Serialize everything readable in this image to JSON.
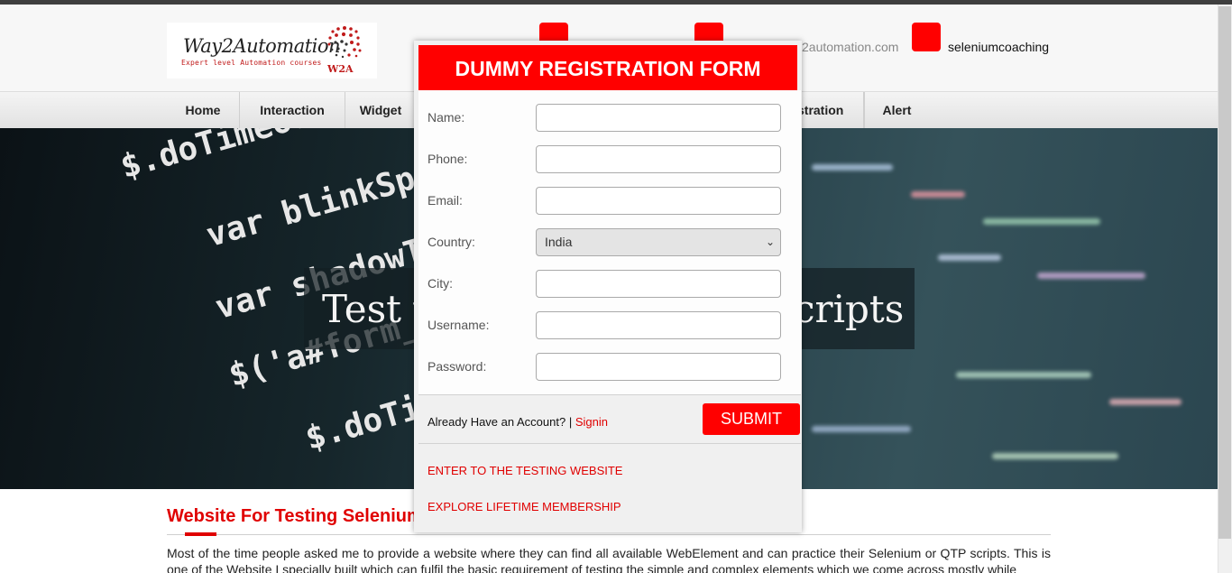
{
  "header": {
    "logo": {
      "title": "Way2Automation",
      "subtitle": "Expert level Automation courses",
      "brand": "W2A"
    },
    "contacts": [
      {
        "icon": "phone-icon",
        "text": ""
      },
      {
        "icon": "email-icon",
        "text": "2automation.com"
      },
      {
        "icon": "skype-icon",
        "text": "seleniumcoaching"
      }
    ]
  },
  "nav": {
    "items": [
      {
        "label": "Home"
      },
      {
        "label": "Interaction"
      },
      {
        "label": "Widget"
      },
      {
        "label": "stration"
      },
      {
        "label": "Alert"
      }
    ]
  },
  "hero": {
    "code_lines": [
      "$.doTimeout('scr",
      "var blinkSpe",
      "var shadowT",
      "$('a#form_s",
      "$.doTi"
    ],
    "tagline": "Test y",
    "tagline_tail": "cripts"
  },
  "content": {
    "section_title": "Website For Testing Selenium",
    "paragraph": "Most of the time people asked me to provide a website where they can find all available WebElement and can practice their Selenium or QTP scripts. This is one of the Website I specially built which can fulfil the basic requirement of testing the simple and complex elements which we come across mostly while"
  },
  "modal": {
    "title": "DUMMY REGISTRATION FORM",
    "fields": [
      {
        "label": "Name:",
        "value": ""
      },
      {
        "label": "Phone:",
        "value": ""
      },
      {
        "label": "Email:",
        "value": ""
      },
      {
        "label": "Country:",
        "value": "India"
      },
      {
        "label": "City:",
        "value": ""
      },
      {
        "label": "Username:",
        "value": ""
      },
      {
        "label": "Password:",
        "value": ""
      }
    ],
    "already_text": "Already Have an Account? |",
    "signin_label": "Signin",
    "submit_label": "SUBMIT",
    "links": [
      {
        "label": "ENTER TO THE TESTING WEBSITE"
      },
      {
        "label": "EXPLORE LIFETIME MEMBERSHIP"
      }
    ]
  },
  "colors": {
    "accent": "#ff0000",
    "nav_background": "#e8e8e8",
    "modal_background": "#f0f0f0"
  }
}
